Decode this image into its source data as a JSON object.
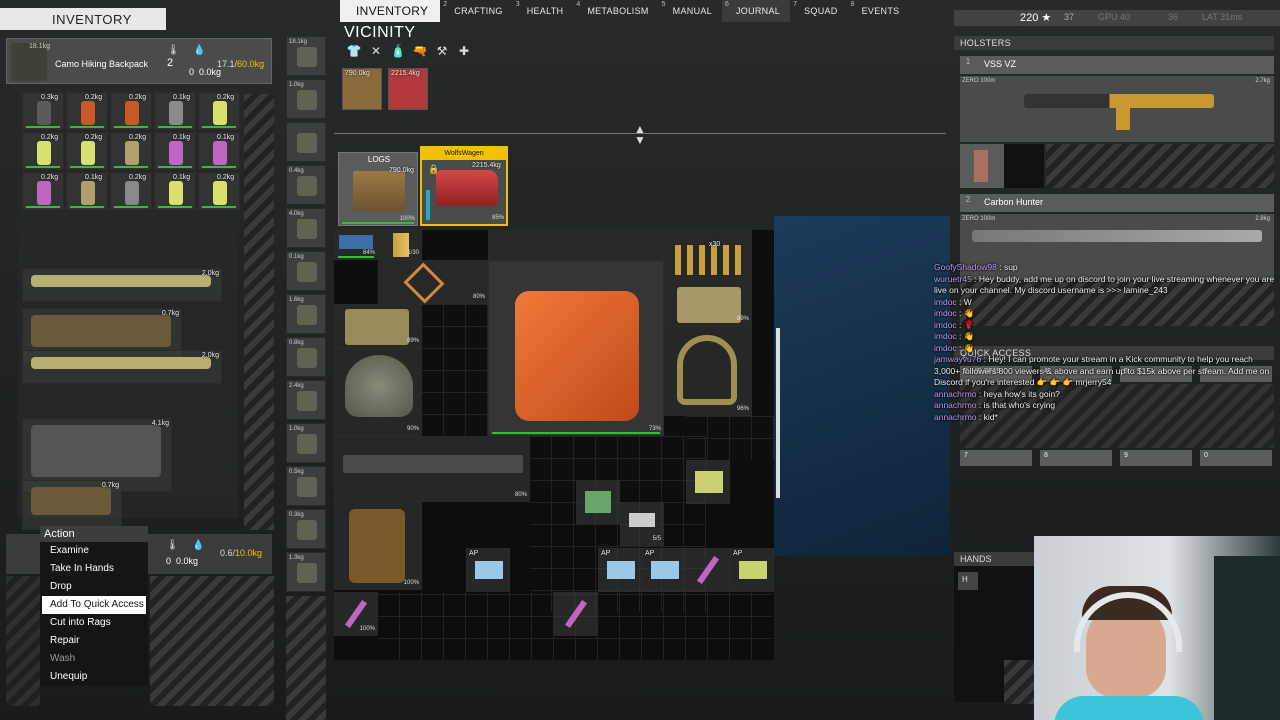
{
  "tabs": [
    {
      "num": "",
      "label": "INVENTORY"
    },
    {
      "num": "2",
      "label": "CRAFTING"
    },
    {
      "num": "3",
      "label": "HEALTH"
    },
    {
      "num": "4",
      "label": "METABOLISM"
    },
    {
      "num": "5",
      "label": "MANUAL"
    },
    {
      "num": "6",
      "label": "JOURNAL"
    },
    {
      "num": "7",
      "label": "SQUAD"
    },
    {
      "num": "8",
      "label": "EVENTS"
    }
  ],
  "inventory": {
    "header": "INVENTORY",
    "backpack": {
      "weight": "18.1kg",
      "name": "Camo Hiking Backpack",
      "count": "2",
      "temp": "0",
      "wetness": "0.0kg",
      "capacity_used": "17.1",
      "capacity_max": "60.0kg",
      "condition": "100%"
    },
    "vest": {
      "temp": "0",
      "wetness": "0.0kg",
      "capacity_used": "0.6",
      "capacity_max": "10.0kg"
    },
    "items_weights": [
      "0.3kg",
      "0.2kg",
      "0.2kg",
      "0.1kg",
      "0.2kg",
      "0.2kg",
      "0.2kg",
      "0.2kg",
      "0.1kg",
      "0.1kg",
      "0.2kg",
      "0.1kg",
      "0.2kg",
      "0.1kg",
      "0.2kg",
      "0.2kg",
      "2.0kg",
      "0.2kg",
      "0.0kg",
      "0.7kg",
      "2.0kg",
      "0.2kg",
      "4.1kg",
      "0.7kg",
      "0.5kg",
      "0.7kg",
      "0.5kg"
    ]
  },
  "action_menu": {
    "title": "Action",
    "items": [
      "Examine",
      "Take In Hands",
      "Drop",
      "Add To Quick Access",
      "Cut into Rags",
      "Repair",
      "Wash",
      "Unequip"
    ]
  },
  "body_slots": [
    "18.1kg",
    "1.0kg",
    "",
    "0.4kg",
    "4.0kg",
    "0.1kg",
    "1.6kg",
    "0.8kg",
    "2.4kg",
    "1.0kg",
    "0.5kg",
    "0.3kg",
    "1.3kg"
  ],
  "vicinity": {
    "title": "VICINITY",
    "strip": [
      {
        "weight": "790.0kg"
      },
      {
        "weight": "2215.4kg"
      }
    ],
    "logs": {
      "label": "LOGS",
      "weight": "790.0kg",
      "condition": "100%"
    },
    "car": {
      "label": "WolfsWagen",
      "weight": "2215.4kg",
      "condition": "85%"
    }
  },
  "car_items": [
    {
      "name": "ammo-box",
      "pct": "84%"
    },
    {
      "name": "bullets",
      "pct": "1/30"
    },
    {
      "name": "rope",
      "pct": "80%"
    },
    {
      "name": "ammo-stack",
      "pct": "x30"
    },
    {
      "name": "jerrycan",
      "pct": "73%"
    },
    {
      "name": "plate-carrier",
      "pct": "89%"
    },
    {
      "name": "helmet",
      "pct": "90%"
    },
    {
      "name": "belt",
      "pct": "96%"
    },
    {
      "name": "smg",
      "pct": "80%"
    },
    {
      "name": "jacket",
      "pct": "100%"
    },
    {
      "name": "knife",
      "pct": "100%"
    },
    {
      "name": "tape",
      "pct": "5/5"
    }
  ],
  "status": {
    "money": "220",
    "rank": "37",
    "gpu": "GPU 40",
    "util": "36",
    "ping": "LAT 31ms"
  },
  "holsters": {
    "title": "HOLSTERS",
    "weapons": [
      {
        "num": "1",
        "name": "VSS VZ",
        "zero": "ZERO 100m",
        "weight": "2.7kg"
      },
      {
        "num": "2",
        "name": "Carbon Hunter",
        "zero": "ZERO 100m",
        "weight": "2.8kg"
      }
    ]
  },
  "quick_access": {
    "title": "QUICK ACCESS",
    "slots": [
      {
        "n": "3",
        "label": "HS SF19"
      },
      {
        "n": "4",
        "label": ""
      },
      {
        "n": "5",
        "label": ""
      },
      {
        "n": "6",
        "label": ""
      },
      {
        "n": "7",
        "label": ""
      },
      {
        "n": "8",
        "label": ""
      },
      {
        "n": "9",
        "label": ""
      },
      {
        "n": "0",
        "label": ""
      }
    ]
  },
  "hands": {
    "title": "HANDS",
    "slot": "H"
  },
  "chat": [
    {
      "u": "GoofyShadow98",
      "m": " : sup"
    },
    {
      "u": "wuruetr45",
      "m": " : Hey buddy, add me up on discord to join your live streaming whenever you are live on your channel. My discord username is >>> lamine_243"
    },
    {
      "u": "imdoc",
      "m": " : W"
    },
    {
      "u": "imdoc",
      "m": " : 👋"
    },
    {
      "u": "imdoc",
      "m": " : 🌹"
    },
    {
      "u": "imdoc",
      "m": " : 👋"
    },
    {
      "u": "imdoc",
      "m": " : 👋"
    },
    {
      "u": "jamwayvu76",
      "m": " : Hey! I can promote your stream in a Kick community to help you reach 3,000+ followers 800 viewers & above and earn up to $15k above per stream. Add me on Discord if you're interested 👉 👉 👉 mrjerry54"
    },
    {
      "u": "annachrmo",
      "m": " : heya how's its goin?"
    },
    {
      "u": "annachrmo",
      "m": " : is that who's crying"
    },
    {
      "u": "annachrmo",
      "m": " : kid*"
    }
  ],
  "colors": {
    "accent": "#f2c200",
    "health": "#2fbf3a",
    "chat_user": "#b99cf0"
  }
}
